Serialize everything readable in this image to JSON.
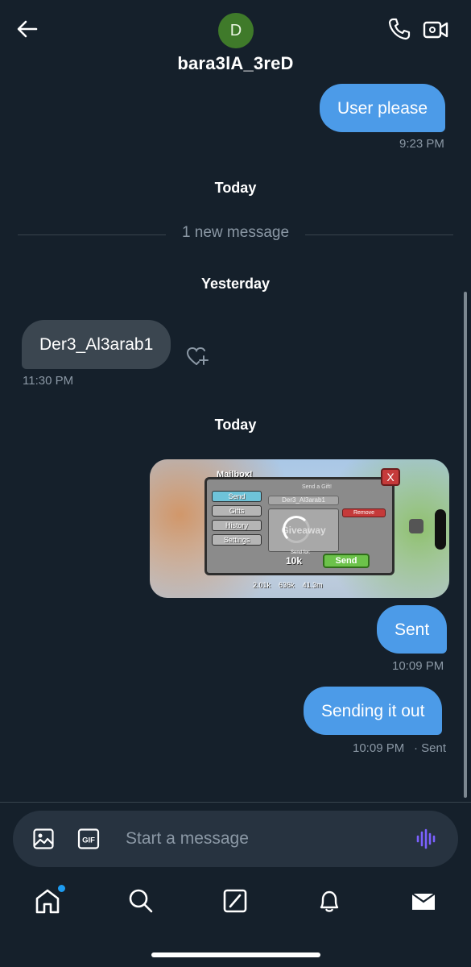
{
  "header": {
    "contact_name": "bara3lA_3reD",
    "avatar_initial": "D"
  },
  "messages": [
    {
      "id": "m1",
      "direction": "outgoing",
      "text": "User please",
      "time": "9:23 PM"
    },
    {
      "id": "d1",
      "day": "Today"
    },
    {
      "id": "new",
      "new_divider": "1 new message"
    },
    {
      "id": "d2",
      "day": "Yesterday"
    },
    {
      "id": "m2",
      "direction": "incoming",
      "text": "Der3_Al3arab1",
      "time": "11:30 PM"
    },
    {
      "id": "d3",
      "day": "Today"
    },
    {
      "id": "m3",
      "direction": "outgoing",
      "type": "image"
    },
    {
      "id": "m4",
      "direction": "outgoing",
      "text": "Sent",
      "time": "10:09 PM"
    },
    {
      "id": "m5",
      "direction": "outgoing",
      "text": "Sending it out",
      "time": "10:09 PM",
      "status": "· Sent"
    }
  ],
  "image_content": {
    "window_title": "Mailbox!",
    "panel_title": "Send a Gift!",
    "tabs": [
      "Send",
      "Gifts",
      "History",
      "Settings"
    ],
    "recipient": "Der3_Al3arab1",
    "item_label": "Giveaway",
    "remove_label": "Remove",
    "send_for_label": "Send for:",
    "cost": "10k",
    "send_label": "Send",
    "close_label": "X",
    "hud": [
      "2.01k",
      "636k",
      "41.3m"
    ]
  },
  "composer": {
    "placeholder": "Start a message"
  },
  "nav": {
    "items": [
      "home",
      "search",
      "grok",
      "notifications",
      "messages"
    ],
    "home_has_badge": true
  },
  "colors": {
    "background": "#15202b",
    "outgoing_bubble": "#4c9be8",
    "incoming_bubble": "#3b4650",
    "muted_text": "#8b98a5",
    "accent_voice": "#7b61ff"
  }
}
